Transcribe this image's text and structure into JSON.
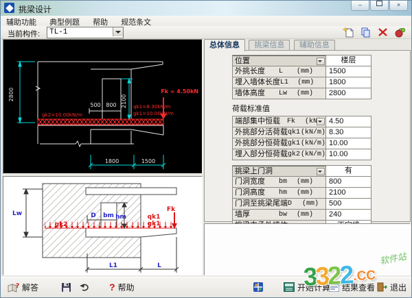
{
  "window": {
    "title": "挑梁设计"
  },
  "caption": {
    "minimize": "–",
    "close": "×"
  },
  "menu": {
    "items": [
      "辅助功能",
      "典型例题",
      "帮助",
      "规范条文"
    ]
  },
  "toolbar": {
    "component_label": "当前构件:",
    "component_value": "TL-1"
  },
  "tabs": [
    "总体信息",
    "挑梁信息",
    "辅助信息"
  ],
  "info": {
    "location": {
      "label": "位置",
      "value": "楼层"
    },
    "geometry_rows": [
      {
        "label": "外挑长度",
        "sym": "L",
        "unit": "(mm)",
        "value": "1500"
      },
      {
        "label": "埋入墙体长度",
        "sym": "L1",
        "unit": "(mm)",
        "value": "1800"
      },
      {
        "label": "墙体高度",
        "sym": "Lw",
        "unit": "(mm)",
        "value": "2800"
      }
    ],
    "load_section_title": "荷载标准值",
    "load_rows": [
      {
        "label": "端部集中恒载",
        "sym": "Fk",
        "unit": "(kN)",
        "value": "4.50"
      },
      {
        "label": "外挑部分活荷载",
        "sym": "qk1",
        "unit": "(kN/m)",
        "value": "8.30"
      },
      {
        "label": "外挑部分恒荷载",
        "sym": "gk1",
        "unit": "(kN/m)",
        "value": "10.00"
      },
      {
        "label": "埋入部分恒荷载",
        "sym": "gk2",
        "unit": "(kN/m)",
        "value": "10.00"
      }
    ],
    "door": {
      "label": "挑梁上门洞",
      "value": "有"
    },
    "door_rows": [
      {
        "label": "门洞宽度",
        "sym": "bm",
        "unit": "(mm)",
        "value": "800"
      },
      {
        "label": "门洞高度",
        "sym": "hm",
        "unit": "(mm)",
        "value": "2100"
      },
      {
        "label": "门洞至挑梁尾端",
        "sym": "D",
        "unit": "(mm)",
        "value": "500"
      },
      {
        "label": "墙厚",
        "sym": "bw",
        "unit": "(mm)",
        "value": "240"
      }
    ],
    "support": {
      "label": "挑梁支承处墙体",
      "value": "丁字墙"
    }
  },
  "cad": {
    "dim_2800": "2800",
    "dim_500": "500",
    "dim_800": "800",
    "dim_2100": "2100",
    "dim_1800": "1800",
    "dim_1500": "1500",
    "fk_label": "Fk = 4.50kN",
    "qk1_label": "qk1=8.30kN/m",
    "gk1_label": "gk1=10.00kN/m",
    "gk2_label": "gk2=10.00kN/m"
  },
  "sketch": {
    "lw": "Lw",
    "gk2": "gk2",
    "d": "D",
    "bm": "bm",
    "hm": "hm",
    "qk1": "qk1",
    "gk1": "gk1",
    "fk": "Fk",
    "l1": "L1",
    "l": "L"
  },
  "statusbar": {
    "answer": "解答",
    "help": "帮助",
    "start": "开始计算",
    "view": "结果查看",
    "exit": "退出"
  },
  "watermark": {
    "d1": "3",
    "d2": "3",
    "d3": "2",
    "d4": "2",
    "cc": ".CC",
    "site": "软件站"
  },
  "colors": {
    "load_red": "#ff2a2a",
    "dim_cyan": "#00dcdc",
    "label_blue": "#2323cc",
    "watermark_orange": "#f58220"
  }
}
